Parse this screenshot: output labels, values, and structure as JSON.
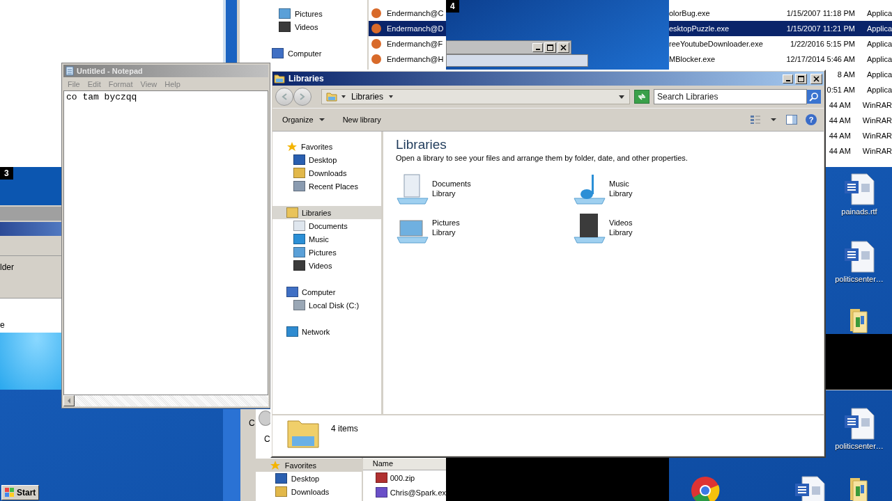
{
  "bg_explorer_top": {
    "nav": [
      {
        "label": "Pictures",
        "kind": "pictures"
      },
      {
        "label": "Videos",
        "kind": "videos"
      },
      {
        "label": "Computer",
        "kind": "computer"
      }
    ],
    "files": [
      {
        "label": "Endermanch@C",
        "selected": false
      },
      {
        "label": "Endermanch@D",
        "selected": true
      },
      {
        "label": "Endermanch@F",
        "selected": false
      },
      {
        "label": "Endermanch@H",
        "selected": false
      }
    ]
  },
  "window_markers": [
    "4",
    "3"
  ],
  "file_list": [
    {
      "name": "olorBug.exe",
      "date": "1/15/2007 11:18 PM",
      "type": "Applica",
      "selected": false
    },
    {
      "name": "esktopPuzzle.exe",
      "date": "1/15/2007 11:21 PM",
      "type": "Applica",
      "selected": true
    },
    {
      "name": "reeYoutubeDownloader.exe",
      "date": "1/22/2016 5:15 PM",
      "type": "Applica",
      "selected": false
    },
    {
      "name": "MBlocker.exe",
      "date": "12/17/2014 5:46 AM",
      "type": "Applica",
      "selected": false
    },
    {
      "date": "8 AM",
      "type": "Applica",
      "selected": false
    },
    {
      "date": "0:51 AM",
      "type": "Applica",
      "selected": false
    },
    {
      "date": "44 AM",
      "type": "WinRAR",
      "selected": false
    },
    {
      "date": "44 AM",
      "type": "WinRAR",
      "selected": false
    },
    {
      "date": "44 AM",
      "type": "WinRAR",
      "selected": false
    },
    {
      "date": "44 AM",
      "type": "WinRAR",
      "selected": false
    }
  ],
  "left_window": {
    "labels": [
      "lder",
      "e"
    ]
  },
  "desktop_icons": [
    {
      "kind": "word",
      "label": "painads.rtf"
    },
    {
      "kind": "word",
      "label": "politicsenter…"
    },
    {
      "kind": "folder"
    },
    {
      "kind": "word",
      "label": "politicsenter…"
    },
    {
      "kind": "folder"
    },
    {
      "kind": "browser"
    },
    {
      "kind": "word"
    }
  ],
  "bg_explorer_bottom": {
    "labels": [
      "C",
      "C"
    ],
    "nav": [
      {
        "label": "Favorites",
        "kind": "favorites"
      },
      {
        "label": "Desktop",
        "kind": "desktop"
      },
      {
        "label": "Downloads",
        "kind": "downloads"
      }
    ],
    "column_header": "Name",
    "files": [
      {
        "label": "000.zip",
        "kind": "archive"
      },
      {
        "label": "Chris@Spark.ex",
        "kind": "program"
      }
    ]
  },
  "notepad": {
    "title": "Untitled - Notepad",
    "active": false,
    "menu": [
      "File",
      "Edit",
      "Format",
      "View",
      "Help"
    ],
    "text": "co tam byczqq"
  },
  "explorer": {
    "title": "Libraries",
    "active": true,
    "breadcrumb": "Libraries",
    "search": {
      "placeholder": "Search Libraries"
    },
    "toolbar": [
      {
        "label": "Organize",
        "dropdown": true
      },
      {
        "label": "New library",
        "dropdown": false
      }
    ],
    "help": "?",
    "nav": [
      {
        "label": "Favorites",
        "kind": "favorites",
        "selected": false,
        "children": [
          {
            "label": "Desktop",
            "kind": "desktop",
            "selected": false
          },
          {
            "label": "Downloads",
            "kind": "downloads",
            "selected": false
          },
          {
            "label": "Recent Places",
            "kind": "recent",
            "selected": false
          }
        ]
      },
      {
        "label": "Libraries",
        "kind": "libraries",
        "selected": true,
        "children": [
          {
            "label": "Documents",
            "kind": "documents",
            "selected": false
          },
          {
            "label": "Music",
            "kind": "music",
            "selected": false
          },
          {
            "label": "Pictures",
            "kind": "pictures",
            "selected": false
          },
          {
            "label": "Videos",
            "kind": "videos",
            "selected": false
          }
        ]
      },
      {
        "label": "Computer",
        "kind": "computer",
        "selected": false,
        "children": [
          {
            "label": "Local Disk (C:)",
            "kind": "disk",
            "selected": false
          }
        ]
      },
      {
        "label": "Network",
        "kind": "network",
        "selected": false
      }
    ],
    "heading": "Libraries",
    "description": "Open a library to see your files and arrange them by folder, date, and other properties.",
    "libraries": [
      {
        "name": "Documents",
        "type": "Library",
        "kind": "documents"
      },
      {
        "name": "Music",
        "type": "Library",
        "kind": "music"
      },
      {
        "name": "Pictures",
        "type": "Library",
        "kind": "pictures"
      },
      {
        "name": "Videos",
        "type": "Library",
        "kind": "videos"
      }
    ],
    "status": "4 items"
  },
  "taskbar": {
    "start": "Start"
  }
}
